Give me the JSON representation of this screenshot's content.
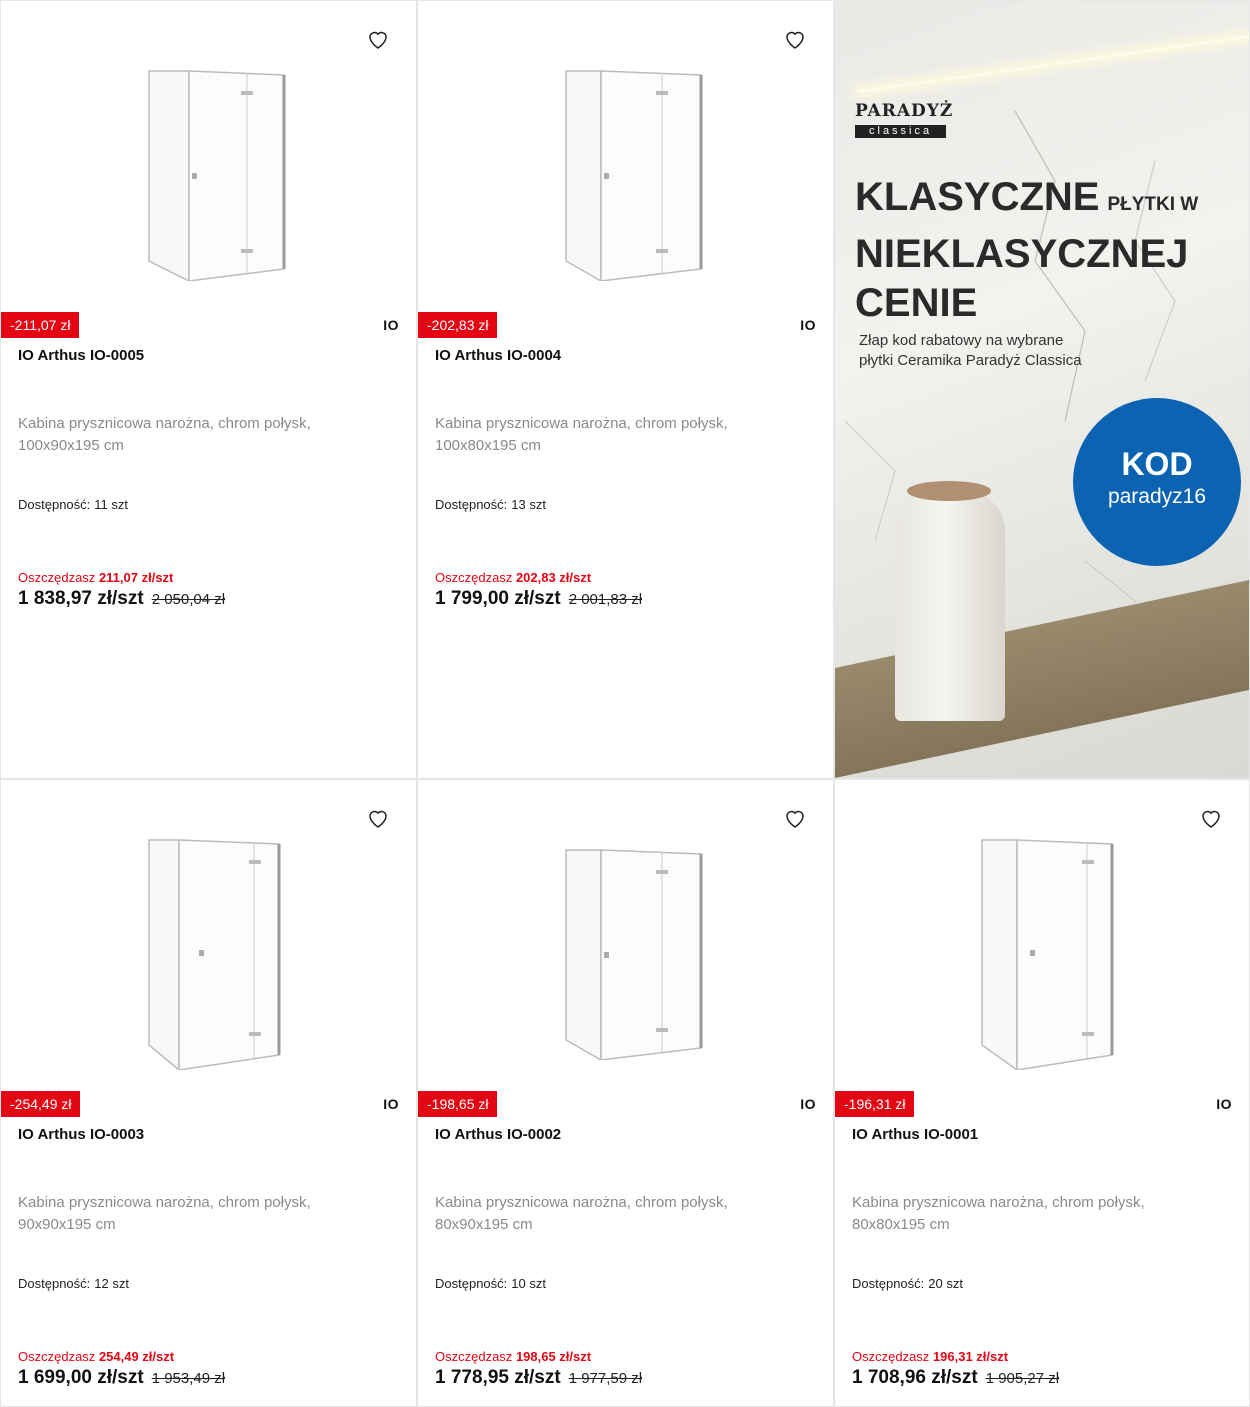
{
  "products": [
    {
      "discount_badge": "-211,07 zł",
      "brand": "IO",
      "name": "IO Arthus IO-0005",
      "desc_line1": "Kabina prysznicowa narożna, chrom połysk,",
      "desc_line2": "100x90x195 cm",
      "availability_label": "Dostępność:",
      "availability_value": "11 szt",
      "save_label": "Oszczędzasz",
      "save_value": "211,07 zł/szt",
      "price": "1 838,97 zł/szt",
      "old_price": "2 050,04 zł"
    },
    {
      "discount_badge": "-202,83 zł",
      "brand": "IO",
      "name": "IO Arthus IO-0004",
      "desc_line1": "Kabina prysznicowa narożna, chrom połysk,",
      "desc_line2": "100x80x195 cm",
      "availability_label": "Dostępność:",
      "availability_value": "13 szt",
      "save_label": "Oszczędzasz",
      "save_value": "202,83 zł/szt",
      "price": "1 799,00 zł/szt",
      "old_price": "2 001,83 zł"
    },
    {
      "discount_badge": "-254,49 zł",
      "brand": "IO",
      "name": "IO Arthus IO-0003",
      "desc_line1": "Kabina prysznicowa narożna, chrom połysk,",
      "desc_line2": "90x90x195 cm",
      "availability_label": "Dostępność:",
      "availability_value": "12 szt",
      "save_label": "Oszczędzasz",
      "save_value": "254,49 zł/szt",
      "price": "1 699,00 zł/szt",
      "old_price": "1 953,49 zł"
    },
    {
      "discount_badge": "-198,65 zł",
      "brand": "IO",
      "name": "IO Arthus IO-0002",
      "desc_line1": "Kabina prysznicowa narożna, chrom połysk,",
      "desc_line2": "80x90x195 cm",
      "availability_label": "Dostępność:",
      "availability_value": "10 szt",
      "save_label": "Oszczędzasz",
      "save_value": "198,65 zł/szt",
      "price": "1 778,95 zł/szt",
      "old_price": "1 977,59 zł"
    },
    {
      "discount_badge": "-196,31 zł",
      "brand": "IO",
      "name": "IO Arthus IO-0001",
      "desc_line1": "Kabina prysznicowa narożna, chrom połysk,",
      "desc_line2": "80x80x195 cm",
      "availability_label": "Dostępność:",
      "availability_value": "20 szt",
      "save_label": "Oszczędzasz",
      "save_value": "196,31 zł/szt",
      "price": "1 708,96 zł/szt",
      "old_price": "1 905,27 zł"
    }
  ],
  "banner": {
    "logo_top": "PARADYŻ",
    "logo_bottom": "classica",
    "headline_1": "KLASYCZNE",
    "headline_1_small": "PŁYTKI W",
    "headline_2": "NIEKLASYCZNEJ",
    "headline_3": "CENIE",
    "subtext_1": "Złap kod rabatowy na wybrane",
    "subtext_2": "płytki Ceramika Paradyż Classica",
    "kod_label": "KOD",
    "kod_value": "paradyz16"
  },
  "icons": {
    "favorite": "heart-outline-icon"
  },
  "colors": {
    "accent": "#e30613",
    "promo_blue": "#0b63b2"
  }
}
